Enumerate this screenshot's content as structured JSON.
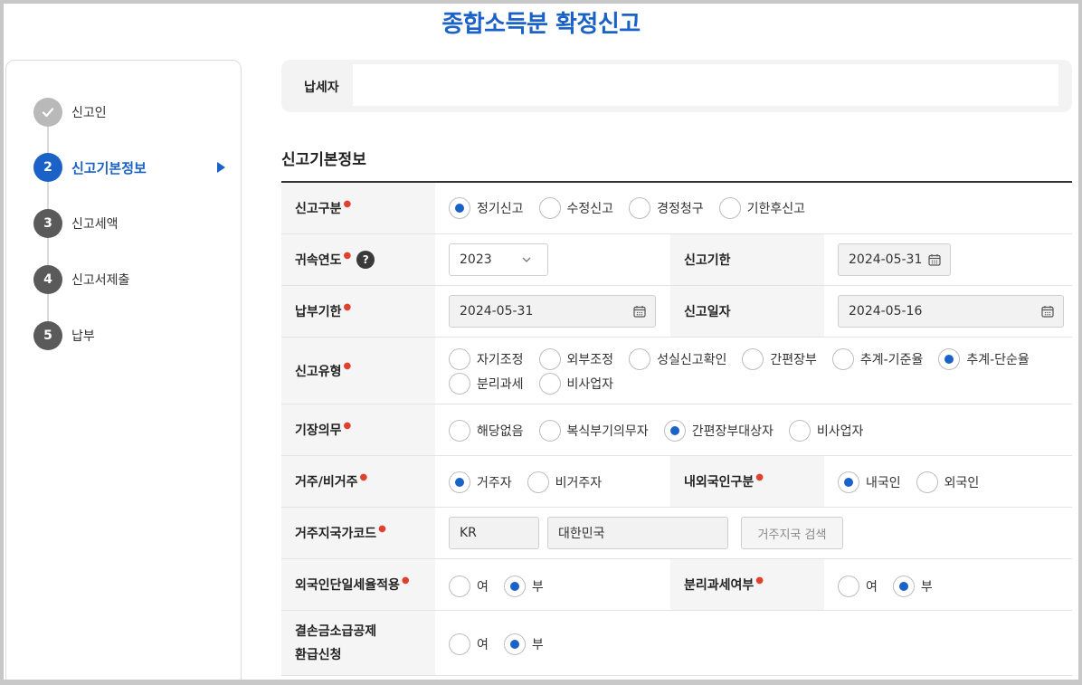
{
  "page": {
    "title": "종합소득분 확정신고"
  },
  "steps": [
    {
      "num": "✓",
      "label": "신고인",
      "state": "done"
    },
    {
      "num": "2",
      "label": "신고기본정보",
      "state": "active"
    },
    {
      "num": "3",
      "label": "신고세액",
      "state": "todo"
    },
    {
      "num": "4",
      "label": "신고서제출",
      "state": "todo"
    },
    {
      "num": "5",
      "label": "납부",
      "state": "todo"
    }
  ],
  "taxpayer": {
    "label": "납세자",
    "value": ""
  },
  "section": {
    "title": "신고기본정보"
  },
  "form": {
    "report_type": {
      "label": "신고구분",
      "options": [
        "정기신고",
        "수정신고",
        "경정청구",
        "기한후신고"
      ],
      "selected": "정기신고"
    },
    "year": {
      "label": "귀속연도",
      "help": "?",
      "value": "2023"
    },
    "deadline": {
      "label": "신고기한",
      "value": "2024-05-31"
    },
    "pay_deadline": {
      "label": "납부기한",
      "value": "2024-05-31"
    },
    "report_date": {
      "label": "신고일자",
      "value": "2024-05-16"
    },
    "report_kind": {
      "label": "신고유형",
      "options": [
        "자기조정",
        "외부조정",
        "성실신고확인",
        "간편장부",
        "추계-기준율",
        "추계-단순율",
        "분리과세",
        "비사업자"
      ],
      "selected": "추계-단순율"
    },
    "bookkeeping": {
      "label": "기장의무",
      "options": [
        "해당없음",
        "복식부기의무자",
        "간편장부대상자",
        "비사업자"
      ],
      "selected": "간편장부대상자"
    },
    "residency": {
      "label": "거주/비거주",
      "options": [
        "거주자",
        "비거주자"
      ],
      "selected": "거주자"
    },
    "nationality": {
      "label": "내외국인구분",
      "options": [
        "내국인",
        "외국인"
      ],
      "selected": "내국인"
    },
    "country": {
      "label": "거주지국가코드",
      "code": "KR",
      "name": "대한민국",
      "search_button": "거주지국 검색"
    },
    "foreign_flat_tax": {
      "label": "외국인단일세율적용",
      "options": [
        "여",
        "부"
      ],
      "selected": "부"
    },
    "separate_tax": {
      "label": "분리과세여부",
      "options": [
        "여",
        "부"
      ],
      "selected": "부"
    },
    "loss_refund": {
      "label_line1": "결손금소급공제",
      "label_line2": "환급신청",
      "options": [
        "여",
        "부"
      ],
      "selected": "부"
    }
  }
}
